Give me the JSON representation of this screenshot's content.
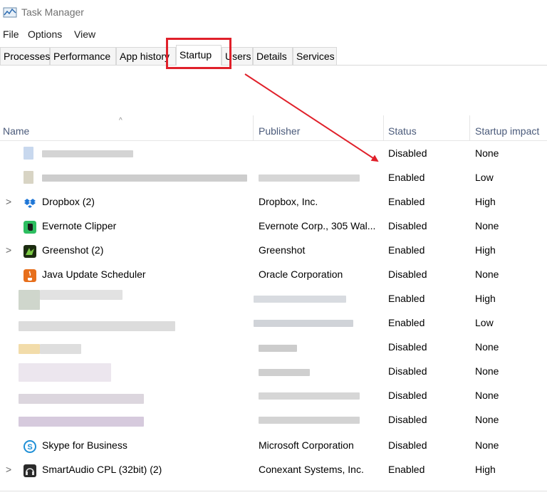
{
  "window": {
    "title": "Task Manager",
    "icon": "task-manager-icon"
  },
  "menu": [
    "File",
    "Options",
    "View"
  ],
  "tabs": [
    "Processes",
    "Performance",
    "App history",
    "Startup",
    "Users",
    "Details",
    "Services"
  ],
  "active_tab": "Startup",
  "columns": {
    "name": "Name",
    "publisher": "Publisher",
    "status": "Status",
    "impact": "Startup impact",
    "sort_indicator": "^"
  },
  "rows": [
    {
      "name": "",
      "publisher": "",
      "status": "Disabled",
      "impact": "None",
      "expander": ""
    },
    {
      "name": "",
      "publisher": "",
      "status": "Enabled",
      "impact": "Low",
      "expander": ""
    },
    {
      "name": "Dropbox (2)",
      "publisher": "Dropbox, Inc.",
      "status": "Enabled",
      "impact": "High",
      "expander": ">",
      "icon": "dropbox-icon"
    },
    {
      "name": "Evernote Clipper",
      "publisher": "Evernote Corp., 305 Wal...",
      "status": "Disabled",
      "impact": "None",
      "expander": "",
      "icon": "evernote-icon"
    },
    {
      "name": "Greenshot (2)",
      "publisher": "Greenshot",
      "status": "Enabled",
      "impact": "High",
      "expander": ">",
      "icon": "greenshot-icon"
    },
    {
      "name": "Java Update Scheduler",
      "publisher": "Oracle Corporation",
      "status": "Disabled",
      "impact": "None",
      "expander": "",
      "icon": "java-icon"
    },
    {
      "name": "",
      "publisher": "",
      "status": "Enabled",
      "impact": "High",
      "expander": ""
    },
    {
      "name": "",
      "publisher": "",
      "status": "Enabled",
      "impact": "Low",
      "expander": ""
    },
    {
      "name": "",
      "publisher": "",
      "status": "Disabled",
      "impact": "None",
      "expander": ""
    },
    {
      "name": "",
      "publisher": "",
      "status": "Disabled",
      "impact": "None",
      "expander": ""
    },
    {
      "name": "",
      "publisher": "",
      "status": "Disabled",
      "impact": "None",
      "expander": ""
    },
    {
      "name": "",
      "publisher": "",
      "status": "Disabled",
      "impact": "None",
      "expander": ""
    },
    {
      "name": "Skype for Business",
      "publisher": "Microsoft Corporation",
      "status": "Disabled",
      "impact": "None",
      "expander": "",
      "icon": "skype-icon"
    },
    {
      "name": "SmartAudio CPL (32bit) (2)",
      "publisher": "Conexant Systems, Inc.",
      "status": "Enabled",
      "impact": "High",
      "expander": ">",
      "icon": "smartaudio-icon"
    }
  ],
  "annotation": {
    "highlight_color": "#e0202a",
    "arrow_color": "#e0202a"
  }
}
